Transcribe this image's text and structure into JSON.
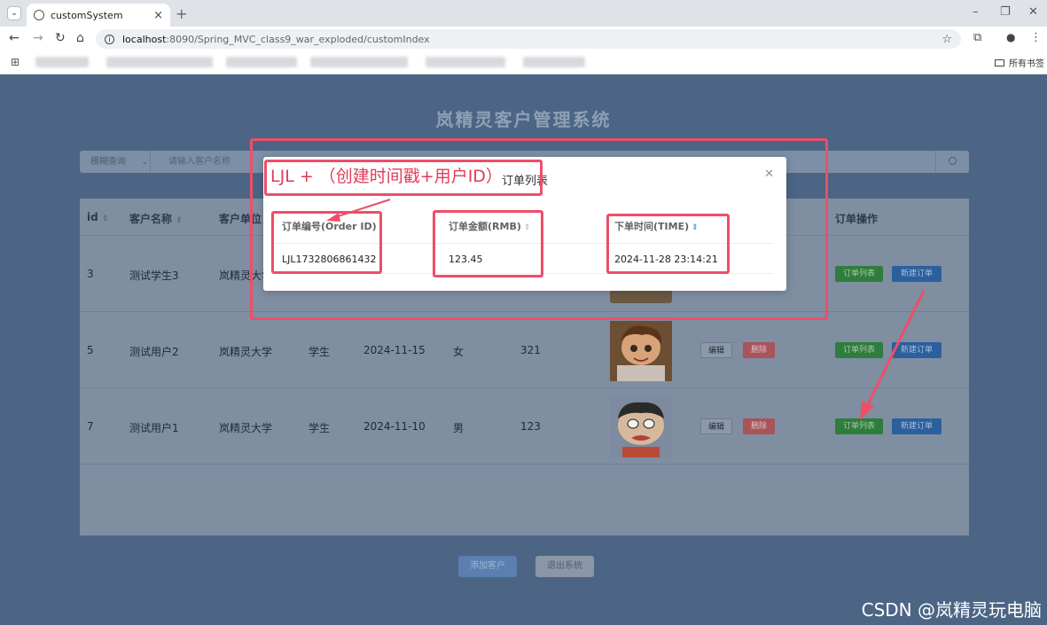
{
  "browser": {
    "tab_title": "customSystem",
    "url_host": "localhost",
    "url_rest": ":8090/Spring_MVC_class9_war_exploded/customIndex",
    "all_bookmarks": "所有书签"
  },
  "app": {
    "title": "岚精灵客户管理系统",
    "search": {
      "mode": "模糊查询",
      "placeholder": "请输入客户名称"
    },
    "table": {
      "headers": [
        "id",
        "客户名称",
        "客户单位",
        "订单操作"
      ],
      "rows": [
        {
          "id": "3",
          "name": "测试学生3",
          "company": "岚精灵大学",
          "role": "",
          "date": "",
          "gender": "",
          "num": ""
        },
        {
          "id": "5",
          "name": "测试用户2",
          "company": "岚精灵大学",
          "role": "学生",
          "date": "2024-11-15",
          "gender": "女",
          "num": "321"
        },
        {
          "id": "7",
          "name": "测试用户1",
          "company": "岚精灵大学",
          "role": "学生",
          "date": "2024-11-10",
          "gender": "男",
          "num": "123"
        }
      ],
      "edit_label": "编辑",
      "delete_label": "删除",
      "order_list_label": "订单列表",
      "new_order_label": "新建订单"
    },
    "add_customer": "添加客户",
    "exit_system": "退出系统"
  },
  "modal": {
    "title": "订单列表",
    "headers": {
      "order_id": "订单编号(Order ID)",
      "amount": "订单金额(RMB)",
      "time": "下单时间(TIME)"
    },
    "row": {
      "order_id": "LJL1732806861432",
      "amount": "123.45",
      "time": "2024-11-28 23:14:21"
    }
  },
  "annotation": {
    "text": "LJL + （创建时间戳+用户ID）",
    "color": "#ee4e68"
  },
  "watermark": "CSDN @岚精灵玩电脑"
}
